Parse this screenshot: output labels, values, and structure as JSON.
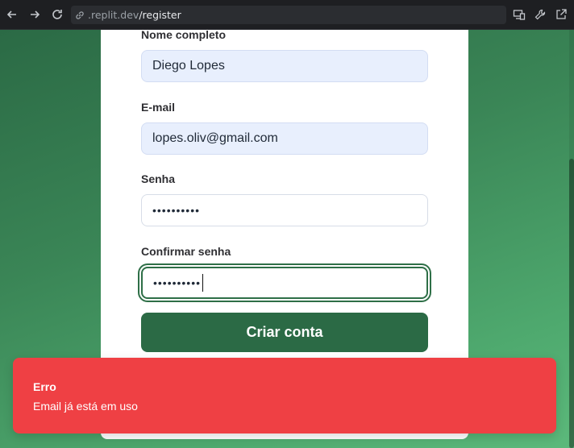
{
  "browser": {
    "url_domain": ".replit.dev",
    "url_path": "/register",
    "icons": [
      "back-icon",
      "forward-icon",
      "reload-icon",
      "link-icon",
      "devices-icon",
      "wrench-icon",
      "open-external-icon"
    ]
  },
  "form": {
    "name_label": "Nome completo",
    "name_value": "Diego Lopes",
    "email_label": "E-mail",
    "email_value": "lopes.oliv@gmail.com",
    "password_label": "Senha",
    "password_value": "••••••••••",
    "confirm_label": "Confirmar senha",
    "confirm_value": "••••••••••",
    "submit_label": "Criar conta"
  },
  "toast": {
    "title": "Erro",
    "message": "Email já está em uso"
  },
  "colors": {
    "primary": "#2b6a45",
    "error": "#ef4044",
    "autofill": "#e8effd"
  }
}
